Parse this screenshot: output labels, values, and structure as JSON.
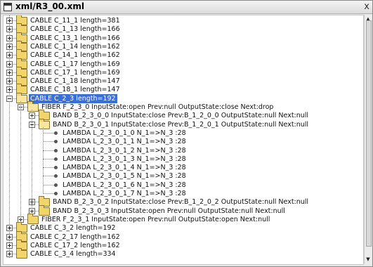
{
  "window": {
    "title": "xml/R3_00.xml",
    "close_glyph": "x",
    "icon": "window-menu-icon"
  },
  "scrollbar": {
    "up_glyph": "▲",
    "down_glyph": "▼"
  },
  "tree": [
    {
      "label": "CABLE C_11_1 length=381",
      "type": "folder",
      "level": 0,
      "expander": "plus"
    },
    {
      "label": "CABLE C_1_13 length=166",
      "type": "folder",
      "level": 0,
      "expander": "plus"
    },
    {
      "label": "CABLE C_13_1 length=166",
      "type": "folder",
      "level": 0,
      "expander": "plus"
    },
    {
      "label": "CABLE C_1_14 length=162",
      "type": "folder",
      "level": 0,
      "expander": "plus"
    },
    {
      "label": "CABLE C_14_1 length=162",
      "type": "folder",
      "level": 0,
      "expander": "plus"
    },
    {
      "label": "CABLE C_1_17 length=169",
      "type": "folder",
      "level": 0,
      "expander": "plus"
    },
    {
      "label": "CABLE C_17_1 length=169",
      "type": "folder",
      "level": 0,
      "expander": "plus"
    },
    {
      "label": "CABLE C_1_18 length=147",
      "type": "folder",
      "level": 0,
      "expander": "plus"
    },
    {
      "label": "CABLE C_18_1 length=147",
      "type": "folder",
      "level": 0,
      "expander": "plus"
    },
    {
      "label": "CABLE C_2_3 length=192",
      "type": "folder",
      "level": 0,
      "expander": "minus",
      "selected": true
    },
    {
      "label": "FIBER F_2_3_0 InputState:open Prev:null  OutputState:close  Next:drop",
      "type": "folder",
      "level": 1,
      "expander": "minus"
    },
    {
      "label": "BAND B_2_3_0_0 InputState:close Prev:B_1_2_0_0  OutputState:null  Next:null",
      "type": "folder",
      "level": 2,
      "expander": "plus"
    },
    {
      "label": "BAND B_2_3_0_1 InputState:close Prev:B_1_2_0_1  OutputState:null  Next:null",
      "type": "folder",
      "level": 2,
      "expander": "minus"
    },
    {
      "label": "LAMBDA L_2_3_0_1_0  N_1=>N_3 :28",
      "type": "leaf",
      "level": 3
    },
    {
      "label": "LAMBDA L_2_3_0_1_1  N_1=>N_3 :28",
      "type": "leaf",
      "level": 3
    },
    {
      "label": "LAMBDA L_2_3_0_1_2  N_1=>N_3 :28",
      "type": "leaf",
      "level": 3
    },
    {
      "label": "LAMBDA L_2_3_0_1_3  N_1=>N_3 :28",
      "type": "leaf",
      "level": 3
    },
    {
      "label": "LAMBDA L_2_3_0_1_4  N_1=>N_3 :28",
      "type": "leaf",
      "level": 3
    },
    {
      "label": "LAMBDA L_2_3_0_1_5  N_1=>N_3 :28",
      "type": "leaf",
      "level": 3
    },
    {
      "label": "LAMBDA L_2_3_0_1_6  N_1=>N_3 :28",
      "type": "leaf",
      "level": 3
    },
    {
      "label": "LAMBDA L_2_3_0_1_7  N_1=>N_3 :28",
      "type": "leaf",
      "level": 3
    },
    {
      "label": "BAND B_2_3_0_2  InputState:close Prev:B_1_2_0_2  OutputState:null  Next:null",
      "type": "folder",
      "level": 2,
      "expander": "plus"
    },
    {
      "label": "BAND B_2_3_0_3  InputState:open Prev:null  OutputState:null  Next:null",
      "type": "folder",
      "level": 2,
      "expander": "plus"
    },
    {
      "label": "FIBER F_2_3_1  InputState:open Prev:null  OutputState:open  Next:null",
      "type": "folder",
      "level": 1,
      "expander": "plus"
    },
    {
      "label": "CABLE C_3_2 length=192",
      "type": "folder",
      "level": 0,
      "expander": "plus"
    },
    {
      "label": "CABLE C_2_17 length=162",
      "type": "folder",
      "level": 0,
      "expander": "plus"
    },
    {
      "label": "CABLE C_17_2 length=162",
      "type": "folder",
      "level": 0,
      "expander": "plus"
    },
    {
      "label": "CABLE C_3_4 length=334",
      "type": "folder",
      "level": 0,
      "expander": "plus"
    }
  ]
}
